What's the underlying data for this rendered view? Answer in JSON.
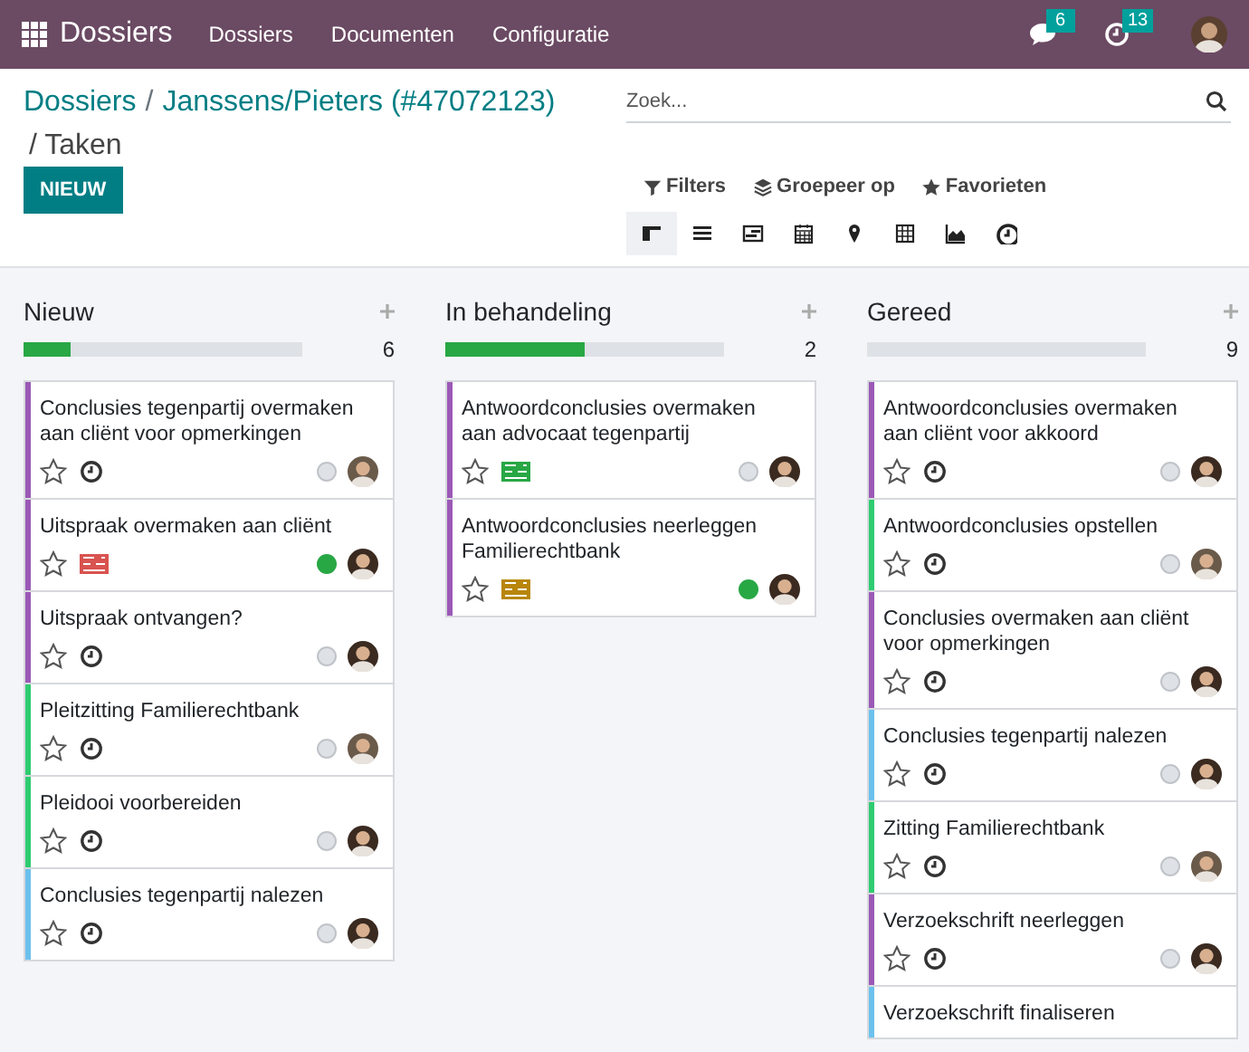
{
  "navbar": {
    "app": "Dossiers",
    "menu": [
      "Dossiers",
      "Documenten",
      "Configuratie"
    ],
    "messages_count": "6",
    "activities_count": "13"
  },
  "breadcrumb": {
    "links": [
      "Dossiers",
      "Janssens/Pieters (#47072123)"
    ],
    "current": "/ Taken",
    "separator": "/"
  },
  "new_button": "NIEUW",
  "search": {
    "placeholder": "Zoek..."
  },
  "filters": [
    {
      "kind": "filter",
      "label": "Filters"
    },
    {
      "kind": "group",
      "label": "Groepeer op"
    },
    {
      "kind": "favorite",
      "label": "Favorieten"
    }
  ],
  "views": [
    {
      "kind": "kanban",
      "selected": true
    },
    {
      "kind": "list",
      "selected": false
    },
    {
      "kind": "gantt",
      "selected": false
    },
    {
      "kind": "calendar",
      "selected": false
    },
    {
      "kind": "map",
      "selected": false
    },
    {
      "kind": "pivot",
      "selected": false
    },
    {
      "kind": "graph",
      "selected": false
    },
    {
      "kind": "activity",
      "selected": false
    }
  ],
  "columns": [
    {
      "title": "Nieuw",
      "count": "6",
      "level": 0.17,
      "cards": [
        {
          "title": "Conclusies tegenpartij overmaken aan cliënt voor opmerkingen",
          "color": "#9b59b6",
          "starred": false,
          "activity": {
            "kind": "clock"
          },
          "done": false
        },
        {
          "title": "Uitspraak overmaken aan cliënt",
          "color": "#9b59b6",
          "starred": false,
          "activity": {
            "kind": "list",
            "color": "#d9534f"
          },
          "done": true
        },
        {
          "title": "Uitspraak ontvangen?",
          "color": "#9b59b6",
          "starred": false,
          "activity": {
            "kind": "clock"
          },
          "done": false
        },
        {
          "title": "Pleitzitting Familierechtbank",
          "color": "#2ecc71",
          "starred": false,
          "activity": {
            "kind": "clock"
          },
          "done": false
        },
        {
          "title": "Pleidooi voorbereiden",
          "color": "#2ecc71",
          "starred": false,
          "activity": {
            "kind": "clock"
          },
          "done": false
        },
        {
          "title": "Conclusies tegenpartij nalezen",
          "color": "#6cc1ed",
          "starred": false,
          "activity": {
            "kind": "clock"
          },
          "done": false
        }
      ]
    },
    {
      "title": "In behandeling",
      "count": "2",
      "level": 0.5,
      "cards": [
        {
          "title": "Antwoordconclusies overmaken aan advocaat tegenpartij",
          "color": "#9b59b6",
          "starred": false,
          "activity": {
            "kind": "list",
            "color": "#28a745"
          },
          "done": false
        },
        {
          "title": "Antwoordconclusies neerleggen Familierechtbank",
          "color": "#9b59b6",
          "starred": false,
          "activity": {
            "kind": "list",
            "color": "#b8860b"
          },
          "done": true
        }
      ]
    },
    {
      "title": "Gereed",
      "count": "9",
      "level": 0,
      "cards": [
        {
          "title": "Antwoordconclusies overmaken aan cliënt voor akkoord",
          "color": "#9b59b6",
          "starred": false,
          "activity": {
            "kind": "clock"
          },
          "done": false
        },
        {
          "title": "Antwoordconclusies opstellen",
          "color": "#2ecc71",
          "starred": false,
          "activity": {
            "kind": "clock"
          },
          "done": false
        },
        {
          "title": "Conclusies overmaken aan cliënt voor opmerkingen",
          "color": "#9b59b6",
          "starred": false,
          "activity": {
            "kind": "clock"
          },
          "done": false
        },
        {
          "title": "Conclusies tegenpartij nalezen",
          "color": "#6cc1ed",
          "starred": false,
          "activity": {
            "kind": "clock"
          },
          "done": false
        },
        {
          "title": "Zitting Familierechtbank",
          "color": "#2ecc71",
          "starred": false,
          "activity": {
            "kind": "clock"
          },
          "done": false
        },
        {
          "title": "Verzoekschrift neerleggen",
          "color": "#9b59b6",
          "starred": false,
          "activity": {
            "kind": "clock"
          },
          "done": false
        },
        {
          "title": "Verzoekschrift finaliseren",
          "color": "#6cc1ed"
        }
      ]
    }
  ]
}
